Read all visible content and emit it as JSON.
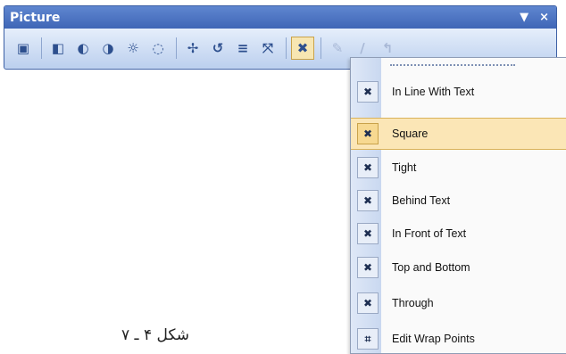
{
  "toolbar": {
    "title": "Picture",
    "dropdown_glyph": "▼",
    "close_glyph": "×",
    "icons": [
      {
        "name": "insert-picture-icon",
        "glyph": "▣"
      },
      {
        "name": "color-icon",
        "glyph": "◧"
      },
      {
        "name": "more-contrast-icon",
        "glyph": "◐"
      },
      {
        "name": "less-contrast-icon",
        "glyph": "◑"
      },
      {
        "name": "more-brightness-icon",
        "glyph": "☼"
      },
      {
        "name": "less-brightness-icon",
        "glyph": "◌"
      },
      {
        "name": "crop-icon",
        "glyph": "✢"
      },
      {
        "name": "rotate-icon",
        "glyph": "↺"
      },
      {
        "name": "line-style-icon",
        "glyph": "≡"
      },
      {
        "name": "compress-icon",
        "glyph": "⤧"
      },
      {
        "name": "text-wrapping-icon",
        "glyph": "✖"
      },
      {
        "name": "format-picture-icon",
        "glyph": "✎"
      },
      {
        "name": "set-transparent-color-icon",
        "glyph": "∕"
      },
      {
        "name": "reset-picture-icon",
        "glyph": "↰"
      }
    ]
  },
  "menu": {
    "items": [
      {
        "label": "In Line With Text",
        "icon": "inline-with-text-icon",
        "glyph": "✖"
      },
      {
        "label": "Square",
        "icon": "square-wrap-icon",
        "glyph": "✖",
        "selected": true
      },
      {
        "label": "Tight",
        "icon": "tight-wrap-icon",
        "glyph": "✖"
      },
      {
        "label": "Behind Text",
        "icon": "behind-text-icon",
        "glyph": "✖"
      },
      {
        "label": "In Front of Text",
        "icon": "in-front-of-text-icon",
        "glyph": "✖"
      },
      {
        "label": "Top and Bottom",
        "icon": "top-bottom-wrap-icon",
        "glyph": "✖"
      },
      {
        "label": "Through",
        "icon": "through-wrap-icon",
        "glyph": "✖"
      },
      {
        "label": "Edit Wrap Points",
        "icon": "edit-wrap-points-icon",
        "glyph": "⌗"
      }
    ]
  },
  "caption": "شکل ۴ ـ ۷"
}
